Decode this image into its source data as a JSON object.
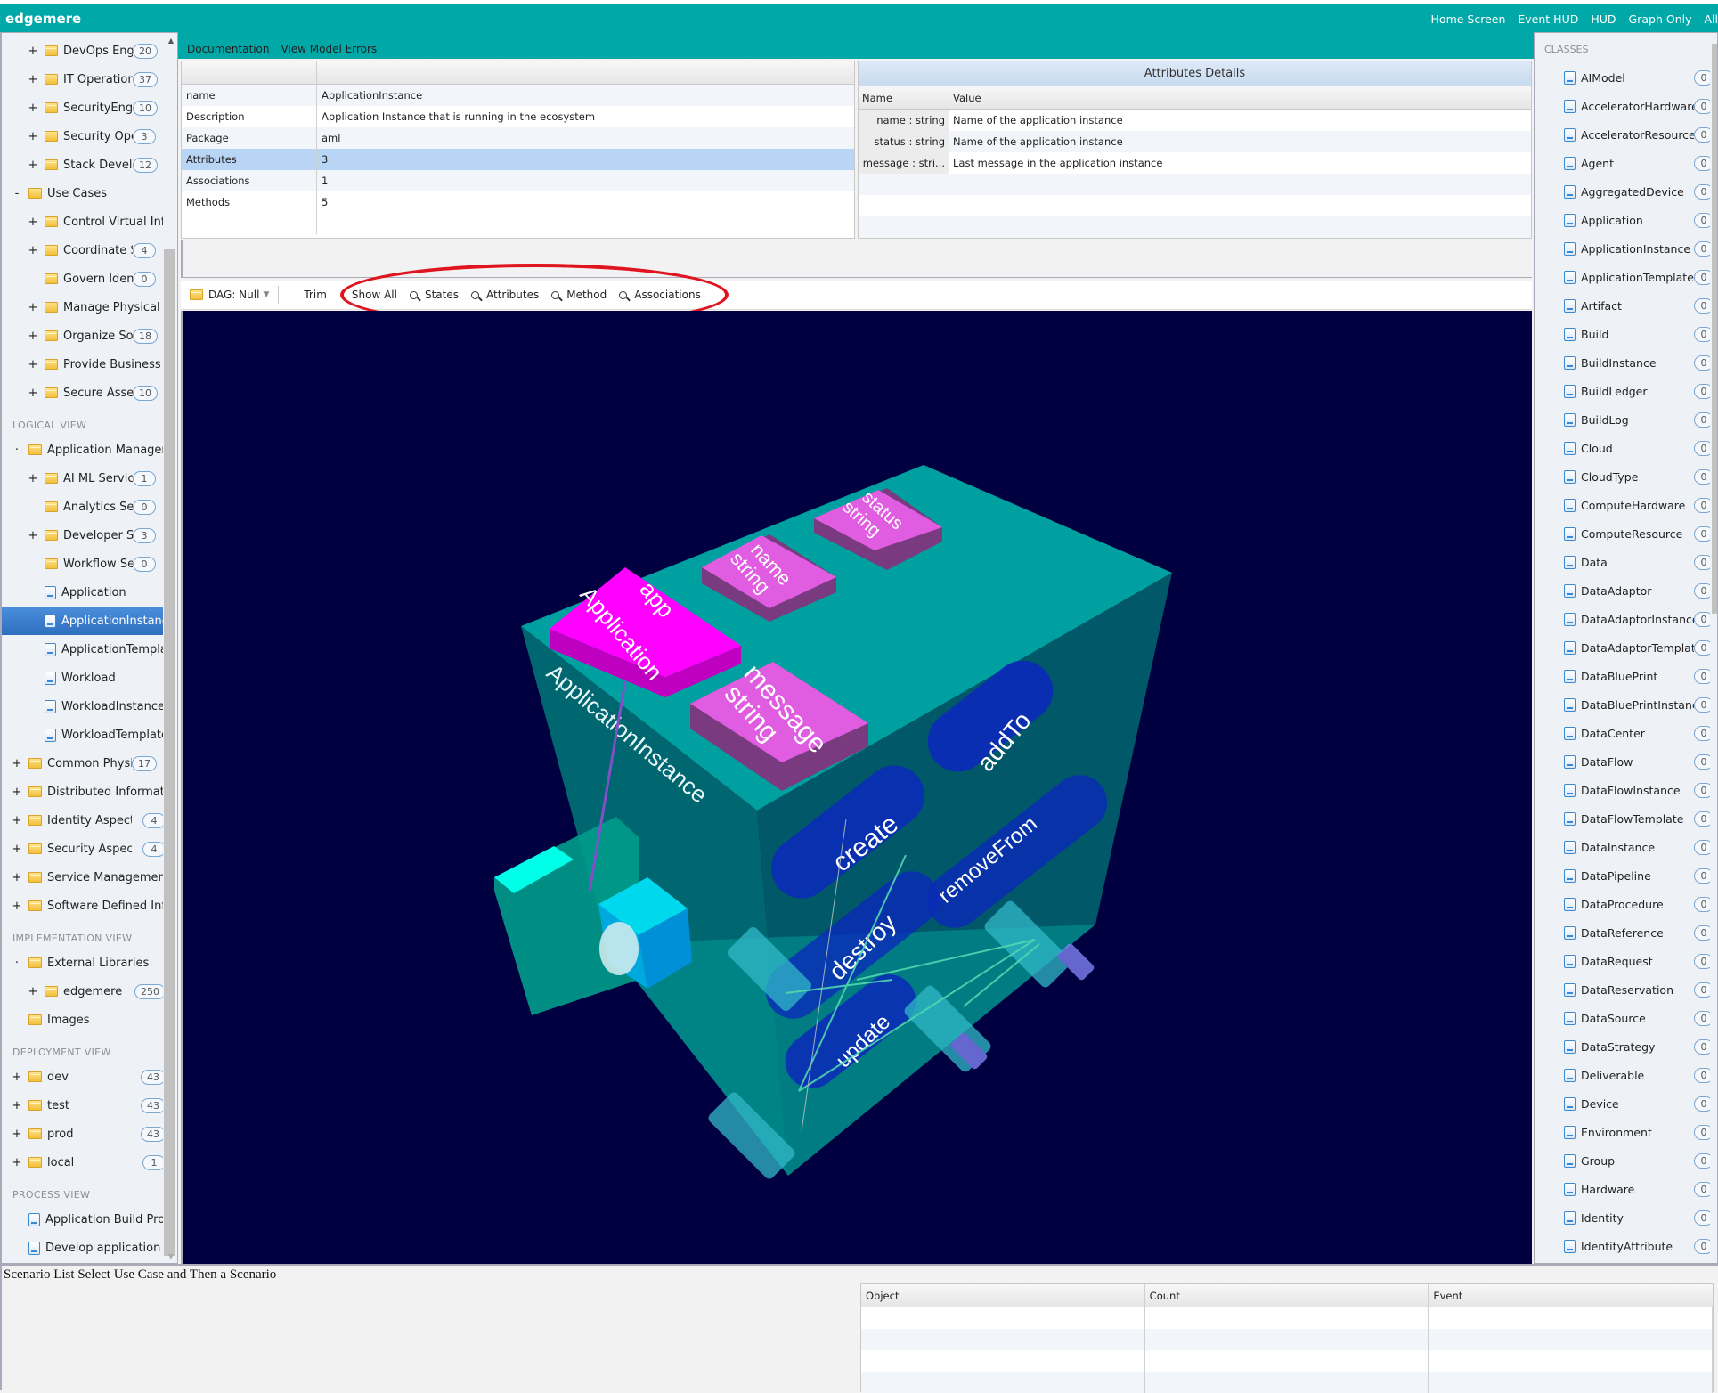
{
  "app": {
    "title": "edgemere",
    "top_nav": [
      "Home Screen",
      "Event HUD",
      "HUD",
      "Graph Only",
      "All"
    ],
    "sub_nav": [
      "Documentation",
      "View Model Errors"
    ]
  },
  "sidebar": {
    "sections": [
      {
        "title": "",
        "items": [
          {
            "toggle": "+",
            "icon": "folder",
            "label": "DevOps Engi",
            "badge": "20",
            "indent": 2
          },
          {
            "toggle": "+",
            "icon": "folder",
            "label": "IT Operation",
            "badge": "37",
            "indent": 2
          },
          {
            "toggle": "+",
            "icon": "folder",
            "label": "SecurityEngi",
            "badge": "10",
            "indent": 2
          },
          {
            "toggle": "+",
            "icon": "folder",
            "label": "Security Oper",
            "badge": "3",
            "indent": 2
          },
          {
            "toggle": "+",
            "icon": "folder",
            "label": "Stack Develo",
            "badge": "12",
            "indent": 2
          },
          {
            "toggle": "-",
            "icon": "folder",
            "label": "Use Cases",
            "badge": "",
            "indent": 1
          },
          {
            "toggle": "+",
            "icon": "folder",
            "label": "Control Virtual Infr",
            "badge": "",
            "indent": 2
          },
          {
            "toggle": "+",
            "icon": "folder",
            "label": "Coordinate Ser",
            "badge": "4",
            "indent": 2
          },
          {
            "toggle": "",
            "icon": "folder",
            "label": "Govern Identit",
            "badge": "0",
            "indent": 2
          },
          {
            "toggle": "+",
            "icon": "folder",
            "label": "Manage Physical Ir",
            "badge": "",
            "indent": 2
          },
          {
            "toggle": "+",
            "icon": "folder",
            "label": "Organize Sol",
            "badge": "18",
            "indent": 2
          },
          {
            "toggle": "+",
            "icon": "folder",
            "label": "Provide Business Ir",
            "badge": "",
            "indent": 2
          },
          {
            "toggle": "+",
            "icon": "folder",
            "label": "Secure Asset",
            "badge": "10",
            "indent": 2
          }
        ]
      },
      {
        "title": "LOGICAL VIEW",
        "items": [
          {
            "toggle": "·",
            "icon": "folder",
            "label": "Application Manageme",
            "badge": "",
            "indent": 1
          },
          {
            "toggle": "+",
            "icon": "folder",
            "label": "AI ML Service",
            "badge": "1",
            "indent": 2
          },
          {
            "toggle": "",
            "icon": "folder",
            "label": "Analytics Serv",
            "badge": "0",
            "indent": 2
          },
          {
            "toggle": "+",
            "icon": "folder",
            "label": "Developer Ser",
            "badge": "3",
            "indent": 2
          },
          {
            "toggle": "",
            "icon": "folder",
            "label": "Workflow Serv",
            "badge": "0",
            "indent": 2
          },
          {
            "toggle": "",
            "icon": "doc",
            "label": "Application",
            "badge": "",
            "indent": 2
          },
          {
            "toggle": "",
            "icon": "doc",
            "label": "ApplicationInstance",
            "badge": "",
            "indent": 2,
            "selected": true
          },
          {
            "toggle": "",
            "icon": "doc",
            "label": "ApplicationTemplat",
            "badge": "",
            "indent": 2
          },
          {
            "toggle": "",
            "icon": "doc",
            "label": "Workload",
            "badge": "",
            "indent": 2
          },
          {
            "toggle": "",
            "icon": "doc",
            "label": "WorkloadInstance",
            "badge": "",
            "indent": 2
          },
          {
            "toggle": "",
            "icon": "doc",
            "label": "WorkloadTemplate",
            "badge": "",
            "indent": 2
          },
          {
            "toggle": "+",
            "icon": "folder",
            "label": "Common Physical",
            "badge": "17",
            "indent": 1
          },
          {
            "toggle": "+",
            "icon": "folder",
            "label": "Distributed Informatic",
            "badge": "",
            "indent": 1
          },
          {
            "toggle": "+",
            "icon": "folder",
            "label": "Identity Aspect",
            "badge": "4",
            "indent": 1
          },
          {
            "toggle": "+",
            "icon": "folder",
            "label": "Security Aspect",
            "badge": "4",
            "indent": 1
          },
          {
            "toggle": "+",
            "icon": "folder",
            "label": "Service Management",
            "badge": "",
            "indent": 1
          },
          {
            "toggle": "+",
            "icon": "folder",
            "label": "Software Defined Infr",
            "badge": "",
            "indent": 1
          }
        ]
      },
      {
        "title": "IMPLEMENTATION VIEW",
        "items": [
          {
            "toggle": "·",
            "icon": "folder",
            "label": "External Libraries",
            "badge": "",
            "indent": 1
          },
          {
            "toggle": "+",
            "icon": "folder",
            "label": "edgemere",
            "badge": "250",
            "indent": 2
          },
          {
            "toggle": "",
            "icon": "folder",
            "label": "Images",
            "badge": "",
            "indent": 1
          }
        ]
      },
      {
        "title": "DEPLOYMENT VIEW",
        "items": [
          {
            "toggle": "+",
            "icon": "folder",
            "label": "dev",
            "badge": "43",
            "indent": 1
          },
          {
            "toggle": "+",
            "icon": "folder",
            "label": "test",
            "badge": "43",
            "indent": 1
          },
          {
            "toggle": "+",
            "icon": "folder",
            "label": "prod",
            "badge": "43",
            "indent": 1
          },
          {
            "toggle": "+",
            "icon": "folder",
            "label": "local",
            "badge": "1",
            "indent": 1
          }
        ]
      },
      {
        "title": "PROCESS VIEW",
        "items": [
          {
            "toggle": "",
            "icon": "doc",
            "label": "Application Build Proc",
            "badge": "",
            "indent": 1
          },
          {
            "toggle": "",
            "icon": "doc",
            "label": "Develop application Pi",
            "badge": "",
            "indent": 1
          }
        ]
      }
    ]
  },
  "properties": {
    "rows": [
      {
        "key": "name",
        "value": "ApplicationInstance"
      },
      {
        "key": "Description",
        "value": "Application Instance that is running in the ecosystem"
      },
      {
        "key": "Package",
        "value": "aml"
      },
      {
        "key": "Attributes",
        "value": "3",
        "selected": true
      },
      {
        "key": "Associations",
        "value": "1"
      },
      {
        "key": "Methods",
        "value": "5"
      }
    ]
  },
  "attributes_details": {
    "title": "Attributes Details",
    "columns": [
      "Name",
      "Value"
    ],
    "rows": [
      {
        "name": "name : string",
        "value": "Name of the application instance"
      },
      {
        "name": "status : string",
        "value": "Name of the application instance"
      },
      {
        "name": "message : stri...",
        "value": "Last message in the application instance"
      }
    ]
  },
  "toolbar": {
    "dag_label": "DAG: Null",
    "trim_label": "Trim",
    "show_all_label": "Show All",
    "filters": [
      "States",
      "Attributes",
      "Method",
      "Associations"
    ]
  },
  "scene": {
    "background": "#000040",
    "class_name": "ApplicationInstance",
    "association": {
      "name": "app",
      "type": "Application"
    },
    "attributes": [
      {
        "name": "name",
        "type": "string"
      },
      {
        "name": "status",
        "type": "string"
      },
      {
        "name": "message",
        "type": "string"
      }
    ],
    "methods": [
      "create",
      "addTo",
      "destroy",
      "removeFrom",
      "update"
    ]
  },
  "classes_panel": {
    "title": "CLASSES",
    "items": [
      {
        "label": "AIModel",
        "count": "0"
      },
      {
        "label": "AcceleratorHardware",
        "count": "0"
      },
      {
        "label": "AcceleratorResource",
        "count": "0"
      },
      {
        "label": "Agent",
        "count": "0"
      },
      {
        "label": "AggregatedDevice",
        "count": "0"
      },
      {
        "label": "Application",
        "count": "0"
      },
      {
        "label": "ApplicationInstance",
        "count": "0"
      },
      {
        "label": "ApplicationTemplate",
        "count": "0"
      },
      {
        "label": "Artifact",
        "count": "0"
      },
      {
        "label": "Build",
        "count": "0"
      },
      {
        "label": "BuildInstance",
        "count": "0"
      },
      {
        "label": "BuildLedger",
        "count": "0"
      },
      {
        "label": "BuildLog",
        "count": "0"
      },
      {
        "label": "Cloud",
        "count": "0"
      },
      {
        "label": "CloudType",
        "count": "0"
      },
      {
        "label": "ComputeHardware",
        "count": "0"
      },
      {
        "label": "ComputeResource",
        "count": "0"
      },
      {
        "label": "Data",
        "count": "0"
      },
      {
        "label": "DataAdaptor",
        "count": "0"
      },
      {
        "label": "DataAdaptorInstance",
        "count": "0"
      },
      {
        "label": "DataAdaptorTemplate",
        "count": "0"
      },
      {
        "label": "DataBluePrint",
        "count": "0"
      },
      {
        "label": "DataBluePrintInstance",
        "count": "0"
      },
      {
        "label": "DataCenter",
        "count": "0"
      },
      {
        "label": "DataFlow",
        "count": "0"
      },
      {
        "label": "DataFlowInstance",
        "count": "0"
      },
      {
        "label": "DataFlowTemplate",
        "count": "0"
      },
      {
        "label": "DataInstance",
        "count": "0"
      },
      {
        "label": "DataPipeline",
        "count": "0"
      },
      {
        "label": "DataProcedure",
        "count": "0"
      },
      {
        "label": "DataReference",
        "count": "0"
      },
      {
        "label": "DataRequest",
        "count": "0"
      },
      {
        "label": "DataReservation",
        "count": "0"
      },
      {
        "label": "DataSource",
        "count": "0"
      },
      {
        "label": "DataStrategy",
        "count": "0"
      },
      {
        "label": "Deliverable",
        "count": "0"
      },
      {
        "label": "Device",
        "count": "0"
      },
      {
        "label": "Environment",
        "count": "0"
      },
      {
        "label": "Group",
        "count": "0"
      },
      {
        "label": "Hardware",
        "count": "0"
      },
      {
        "label": "Identity",
        "count": "0"
      },
      {
        "label": "IdentityAttribute",
        "count": "0"
      }
    ]
  },
  "bottom": {
    "scenario_text": "Scenario List Select Use Case and Then a Scenario",
    "event_columns": [
      "Object",
      "Count",
      "Event"
    ]
  }
}
